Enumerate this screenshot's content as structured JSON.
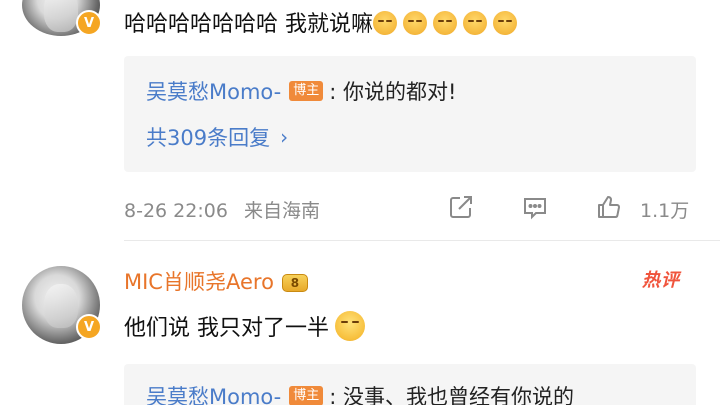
{
  "comments": [
    {
      "text": "哈哈哈哈哈哈哈 我就说嘛",
      "emoji_count": 5,
      "reply_preview": {
        "name": "吴莫愁Momo-",
        "badge": "博主",
        "body": ": 你说的都对!"
      },
      "reply_count_text": "共309条回复",
      "time": "8-26 22:06",
      "source": "来自海南",
      "like_count": "1.1万"
    },
    {
      "username": "MIC肖顺尧Aero",
      "level_badge": "8",
      "hot_tag": "热评",
      "text": "他们说 我只对了一半",
      "reply_preview": {
        "name": "吴莫愁Momo-",
        "badge": "博主",
        "body": ": 没事、我也曾经有你说的"
      }
    }
  ],
  "icons": {
    "verified": "verified-v-icon",
    "share": "share-icon",
    "comment": "comment-icon",
    "like": "thumbs-up-icon",
    "chevron": "chevron-right-icon",
    "emoji": "smile-emoji-icon",
    "laugh": "laugh-emoji-icon"
  },
  "colors": {
    "link_blue": "#4a7cc9",
    "username_orange": "#e8752a",
    "badge_orange": "#f08a3a",
    "hot_red": "#f0543c",
    "meta_gray": "#8a8a8a",
    "reply_bg": "#f5f5f5"
  }
}
